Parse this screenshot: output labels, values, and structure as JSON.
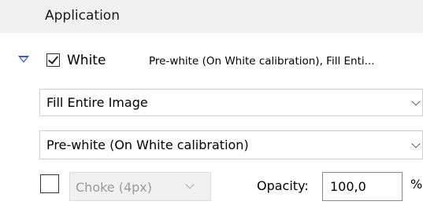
{
  "section": {
    "title": "Application"
  },
  "white_row": {
    "checked": true,
    "label": "White",
    "summary": "Pre-white (On White calibration), Fill Enti..."
  },
  "fill_select": {
    "value": "Fill Entire Image"
  },
  "prewhite_select": {
    "value": "Pre-white (On White calibration)"
  },
  "choke": {
    "checked": false,
    "value": "Choke (4px)",
    "enabled": false
  },
  "opacity": {
    "label": "Opacity:",
    "value": "100,0",
    "unit": "%"
  },
  "icons": {
    "expander": "triangle-down-icon",
    "chevron": "chevron-down-icon"
  },
  "colors": {
    "expander": "#3b5bb4",
    "disabled_text": "#9a9a9a"
  }
}
